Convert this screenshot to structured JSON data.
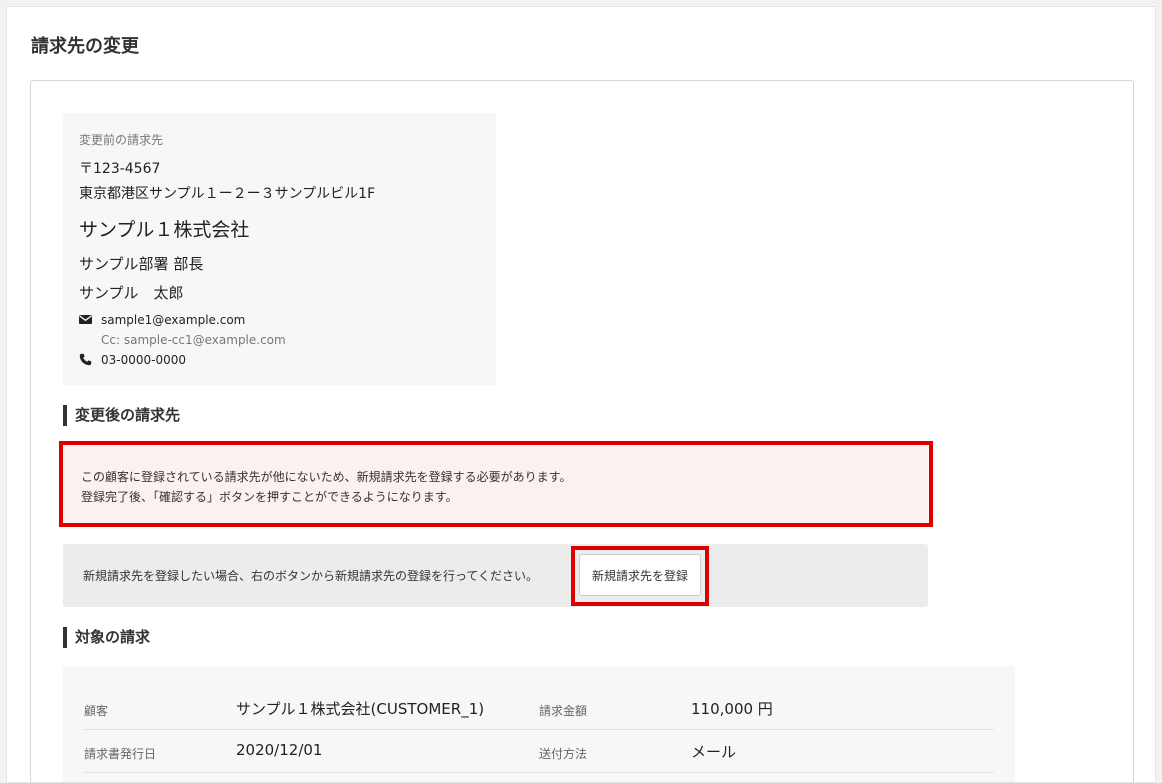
{
  "page": {
    "title": "請求先の変更"
  },
  "before": {
    "label": "変更前の請求先",
    "postal": "〒123-4567",
    "address": "東京都港区サンプル１ー２ー３サンプルビル1F",
    "company": "サンプル１株式会社",
    "department": "サンプル部署 部長",
    "person": "サンプル　太郎",
    "email": "sample1@example.com",
    "cc": "Cc: sample-cc1@example.com",
    "phone": "03-0000-0000"
  },
  "after": {
    "heading": "変更後の請求先",
    "alert_line1": "この顧客に登録されている請求先が他にないため、新規請求先を登録する必要があります。",
    "alert_line2": "登録完了後、「確認する」ボタンを押すことができるようになります。",
    "register_text": "新規請求先を登録したい場合、右のボタンから新規請求先の登録を行ってください。",
    "register_button": "新規請求先を登録"
  },
  "target": {
    "heading": "対象の請求",
    "rows": [
      {
        "label1": "顧客",
        "value1": "サンプル１株式会社(CUSTOMER_1)",
        "label2": "請求金額",
        "value2": "110,000 円"
      },
      {
        "label1": "請求書発行日",
        "value1": "2020/12/01",
        "label2": "送付方法",
        "value2": "メール"
      }
    ]
  },
  "colors": {
    "highlight": "#dd0000",
    "alert_bg": "#fbf1ee"
  }
}
